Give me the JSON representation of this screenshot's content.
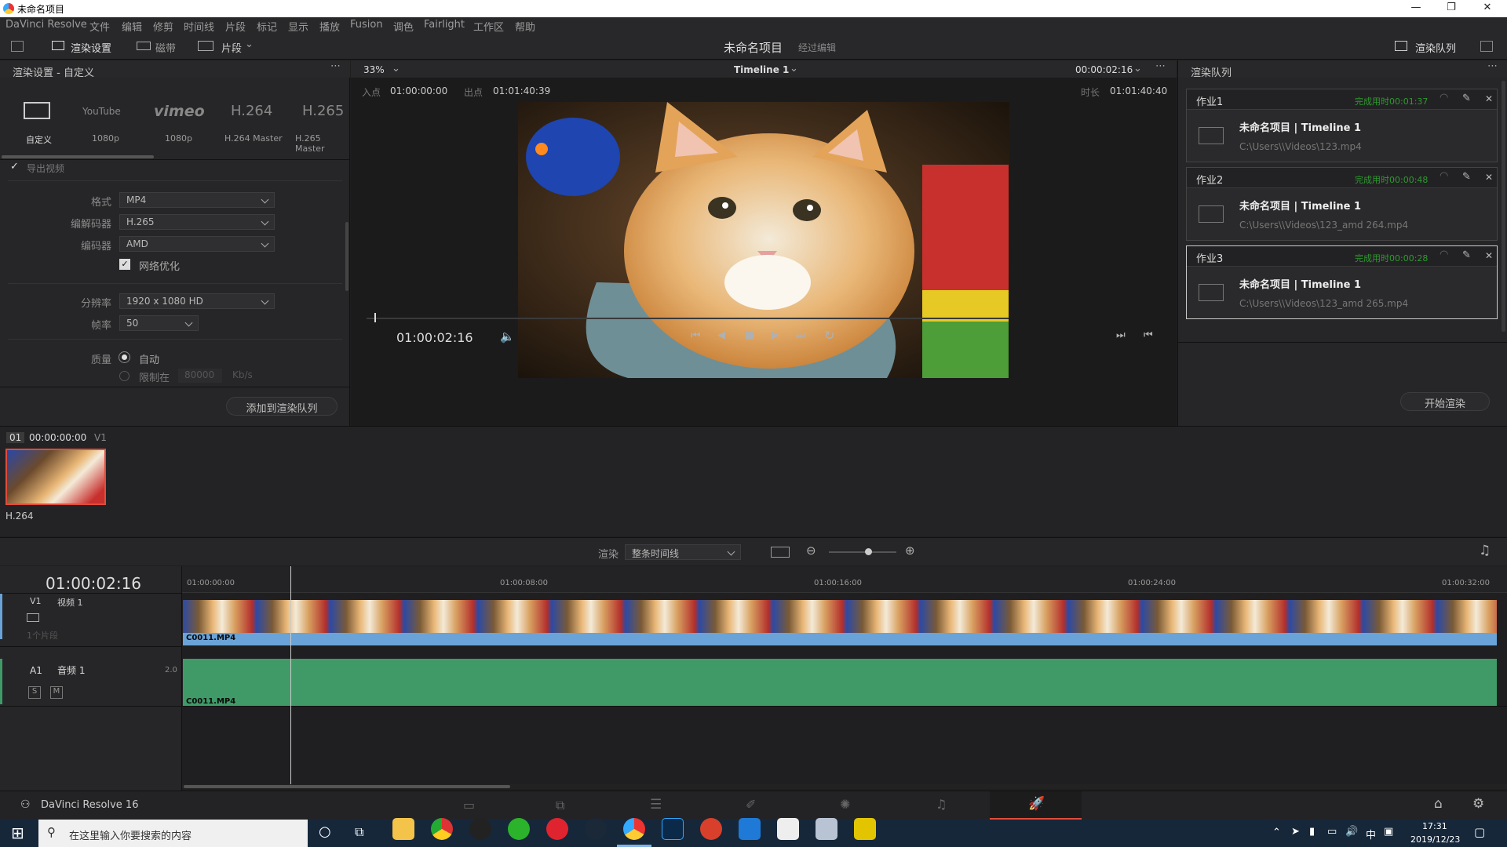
{
  "window": {
    "title": "未命名项目"
  },
  "menu": [
    "DaVinci Resolve",
    "文件",
    "编辑",
    "修剪",
    "时间线",
    "片段",
    "标记",
    "显示",
    "播放",
    "Fusion",
    "调色",
    "Fairlight",
    "工作区",
    "帮助"
  ],
  "toolbar": {
    "render_settings": "渲染设置",
    "disk": "磁带",
    "clips": "片段",
    "project_name": "未命名项目",
    "edit_status": "经过编辑",
    "render_queue": "渲染队列"
  },
  "render_settings": {
    "header": "渲染设置 - 自定义",
    "presets": [
      {
        "name": "自定义",
        "sub": ""
      },
      {
        "name": "YouTube",
        "sub": "1080p"
      },
      {
        "name": "vimeo",
        "sub": "1080p"
      },
      {
        "name": "H.264",
        "sub": "H.264 Master"
      },
      {
        "name": "H.265",
        "sub": "H.265 Master"
      }
    ],
    "export_video": "导出视频",
    "format_label": "格式",
    "format": "MP4",
    "codec_label": "编解码器",
    "codec": "H.265",
    "encoder_label": "编码器",
    "encoder": "AMD",
    "network_opt": "网络优化",
    "resolution_label": "分辨率",
    "resolution": "1920 x 1080 HD",
    "framerate_label": "帧率",
    "framerate": "50",
    "quality_label": "质量",
    "quality_auto": "自动",
    "quality_limit": "限制在",
    "bitrate": "80000",
    "bitrate_unit": "Kb/s",
    "add_queue": "添加到渲染队列"
  },
  "viewer": {
    "zoom": "33%",
    "timeline_name": "Timeline 1",
    "timecode_top": "00:00:02:16",
    "in_label": "入点",
    "in": "01:00:00:00",
    "out_label": "出点",
    "out": "01:01:40:39",
    "dur_label": "时长",
    "duration": "01:01:40:40",
    "current_tc": "01:00:02:16",
    "progress": 0.012
  },
  "queue": {
    "header": "渲染队列",
    "start": "开始渲染",
    "jobs": [
      {
        "name": "作业1",
        "status": "完成用时00:01:37",
        "title": "未命名项目 | Timeline 1",
        "path": "C:\\Users\\\\Videos\\123.mp4"
      },
      {
        "name": "作业2",
        "status": "完成用时00:00:48",
        "title": "未命名项目 | Timeline 1",
        "path": "C:\\Users\\\\Videos\\123_amd 264.mp4"
      },
      {
        "name": "作业3",
        "status": "完成用时00:00:28",
        "title": "未命名项目 | Timeline 1",
        "path": "C:\\Users\\\\Videos\\123_amd 265.mp4"
      }
    ]
  },
  "clips": {
    "index": "01",
    "tc": "00:00:00:00",
    "track": "V1",
    "name": "H.264"
  },
  "timeline": {
    "render_label": "渲染",
    "render_mode": "整条时间线",
    "tc": "01:00:02:16",
    "ruler": [
      "01:00:00:00",
      "01:00:08:00",
      "01:00:16:00",
      "01:00:24:00",
      "01:00:32:00"
    ],
    "v1": {
      "name": "V1",
      "title": "视频 1",
      "clips_count": "1个片段",
      "clip": "C0011.MP4"
    },
    "a1": {
      "name": "A1",
      "title": "音频 1",
      "ch": "2.0",
      "s": "S",
      "m": "M",
      "clip": "C0011.MP4"
    }
  },
  "footer": {
    "app": "DaVinci Resolve 16"
  },
  "taskbar": {
    "search": "在这里输入你要搜索的内容",
    "time": "17:31",
    "date": "2019/12/23",
    "ime": "中"
  },
  "colors": {
    "accent": "#e04c3a",
    "job_done": "#2e9a2e",
    "video_track": "#6aa3d8",
    "audio_track": "#3f9a68"
  }
}
